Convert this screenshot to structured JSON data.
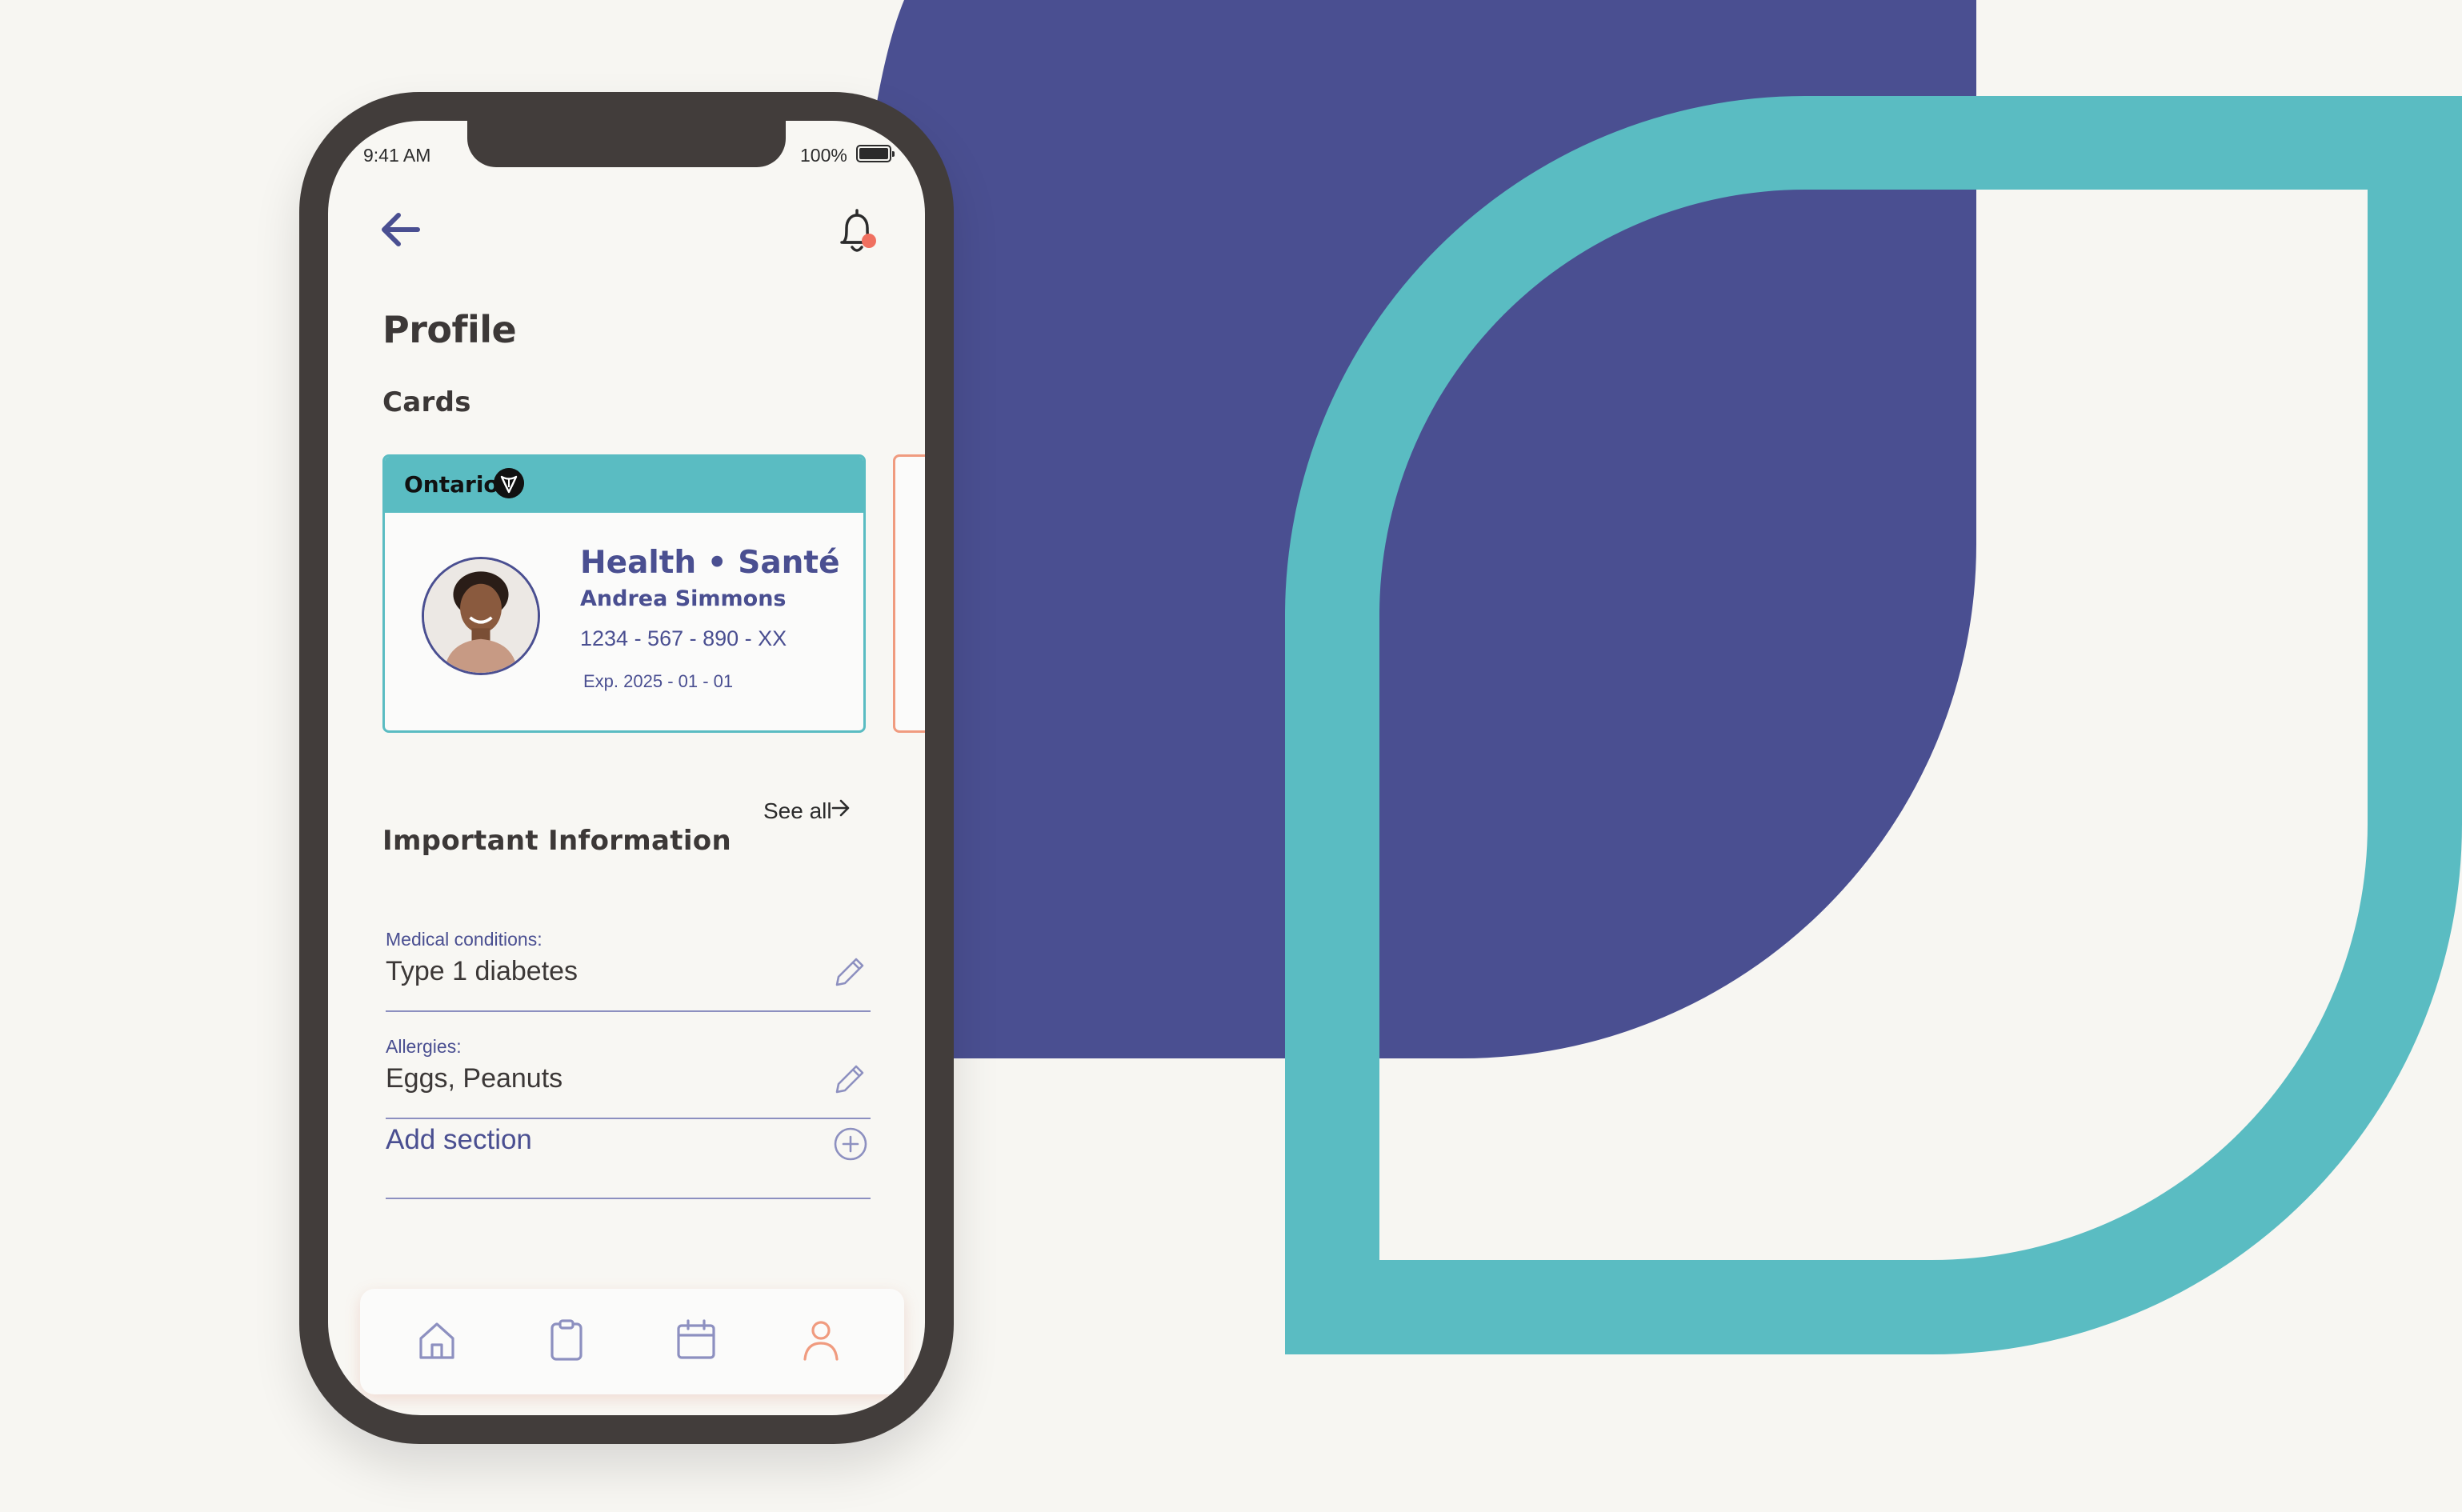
{
  "colors": {
    "background": "#f7f6f2",
    "indigo": "#4a4f91",
    "teal": "#5abcc2",
    "coral": "#f09b7f",
    "phone_frame": "#423d3b"
  },
  "status_bar": {
    "time": "9:41 AM",
    "battery": "100%"
  },
  "header": {
    "back_icon": "arrow-left-icon",
    "notification_icon": "bell-icon"
  },
  "page": {
    "title": "Profile"
  },
  "cards_section": {
    "label": "Cards",
    "card": {
      "province": "Ontario",
      "province_icon": "trillium-icon",
      "title": "Health • Santé",
      "name": "Andrea Simmons",
      "number": "1234 - 567 - 890 - XX",
      "expiry": "Exp. 2025 - 01 - 01"
    },
    "see_all": "See all"
  },
  "info_section": {
    "label": "Important Information",
    "fields": [
      {
        "label": "Medical conditions:",
        "value": "Type 1 diabetes",
        "icon": "pencil-icon"
      },
      {
        "label": "Allergies:",
        "value": "Eggs, Peanuts",
        "icon": "pencil-icon"
      }
    ],
    "add_section": "Add section",
    "add_icon": "plus-circle-icon"
  },
  "tab_bar": {
    "tabs": [
      {
        "icon": "home-icon",
        "active": false
      },
      {
        "icon": "clipboard-icon",
        "active": false
      },
      {
        "icon": "calendar-icon",
        "active": false
      },
      {
        "icon": "user-icon",
        "active": true
      }
    ]
  }
}
